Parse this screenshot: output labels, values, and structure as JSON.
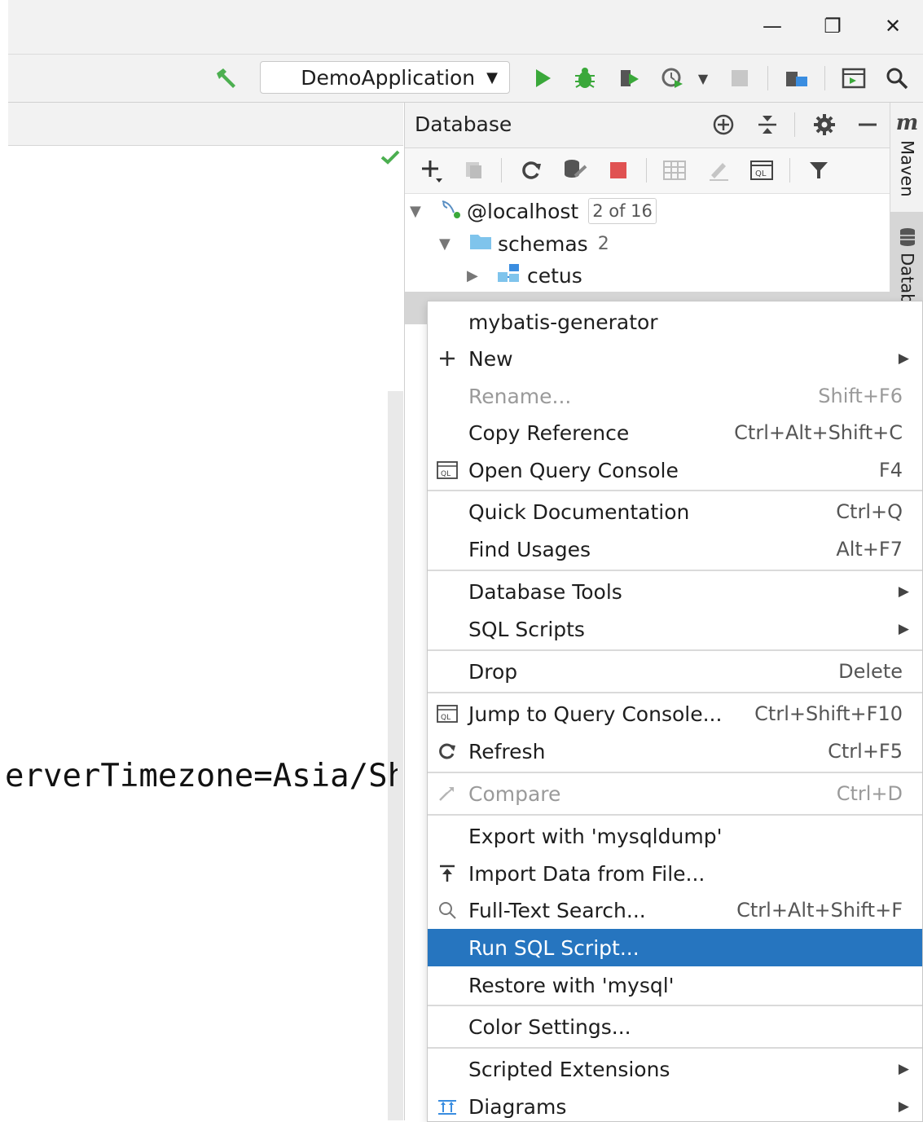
{
  "window": {
    "minimize_glyph": "—",
    "restore_glyph": "❐",
    "close_glyph": "✕"
  },
  "toolbar": {
    "run_config": "DemoApplication",
    "run_config_arrow": "▼"
  },
  "editor": {
    "code_fragment": "erverTimezone=Asia/Sh"
  },
  "database_panel": {
    "title": "Database",
    "tree": {
      "host": "@localhost",
      "host_count": "2 of 16",
      "schemas_label": "schemas",
      "schemas_count": "2",
      "schema_item": "cetus"
    }
  },
  "right_stripe": {
    "maven_label": "Maven",
    "database_label": "Datab",
    "maven_glyph": "m"
  },
  "context_menu": {
    "header": "mybatis-generator",
    "items": [
      {
        "label": "New",
        "shortcut": "",
        "submenu": true,
        "disabled": false,
        "selected": false,
        "icon": "plus-icon"
      },
      {
        "label": "Rename...",
        "shortcut": "Shift+F6",
        "submenu": false,
        "disabled": true,
        "selected": false,
        "icon": ""
      },
      {
        "label": "Copy Reference",
        "shortcut": "Ctrl+Alt+Shift+C",
        "submenu": false,
        "disabled": false,
        "selected": false,
        "icon": ""
      },
      {
        "label": "Open Query Console",
        "shortcut": "F4",
        "submenu": false,
        "disabled": false,
        "selected": false,
        "icon": "ql-console-icon"
      },
      {
        "label": "Quick Documentation",
        "shortcut": "Ctrl+Q",
        "submenu": false,
        "disabled": false,
        "selected": false,
        "icon": ""
      },
      {
        "label": "Find Usages",
        "shortcut": "Alt+F7",
        "submenu": false,
        "disabled": false,
        "selected": false,
        "icon": ""
      },
      {
        "label": "Database Tools",
        "shortcut": "",
        "submenu": true,
        "disabled": false,
        "selected": false,
        "icon": ""
      },
      {
        "label": "SQL Scripts",
        "shortcut": "",
        "submenu": true,
        "disabled": false,
        "selected": false,
        "icon": ""
      },
      {
        "label": "Drop",
        "shortcut": "Delete",
        "submenu": false,
        "disabled": false,
        "selected": false,
        "icon": ""
      },
      {
        "label": "Jump to Query Console...",
        "shortcut": "Ctrl+Shift+F10",
        "submenu": false,
        "disabled": false,
        "selected": false,
        "icon": "ql-console-icon"
      },
      {
        "label": "Refresh",
        "shortcut": "Ctrl+F5",
        "submenu": false,
        "disabled": false,
        "selected": false,
        "icon": "refresh-icon"
      },
      {
        "label": "Compare",
        "shortcut": "Ctrl+D",
        "submenu": false,
        "disabled": true,
        "selected": false,
        "icon": "compare-icon"
      },
      {
        "label": "Export with 'mysqldump'",
        "shortcut": "",
        "submenu": false,
        "disabled": false,
        "selected": false,
        "icon": ""
      },
      {
        "label": "Import Data from File...",
        "shortcut": "",
        "submenu": false,
        "disabled": false,
        "selected": false,
        "icon": "import-icon"
      },
      {
        "label": "Full-Text Search...",
        "shortcut": "Ctrl+Alt+Shift+F",
        "submenu": false,
        "disabled": false,
        "selected": false,
        "icon": "search-icon"
      },
      {
        "label": "Run SQL Script...",
        "shortcut": "",
        "submenu": false,
        "disabled": false,
        "selected": true,
        "icon": ""
      },
      {
        "label": "Restore with 'mysql'",
        "shortcut": "",
        "submenu": false,
        "disabled": false,
        "selected": false,
        "icon": ""
      },
      {
        "label": "Color Settings...",
        "shortcut": "",
        "submenu": false,
        "disabled": false,
        "selected": false,
        "icon": ""
      },
      {
        "label": "Scripted Extensions",
        "shortcut": "",
        "submenu": true,
        "disabled": false,
        "selected": false,
        "icon": ""
      },
      {
        "label": "Diagrams",
        "shortcut": "",
        "submenu": true,
        "disabled": false,
        "selected": false,
        "icon": "diagram-icon"
      }
    ],
    "submenu_arrow": "▶"
  },
  "colors": {
    "selection": "#2675bf",
    "run_green": "#3aa83a",
    "stop_red": "#e05252",
    "folder_blue": "#7fc4ec"
  }
}
